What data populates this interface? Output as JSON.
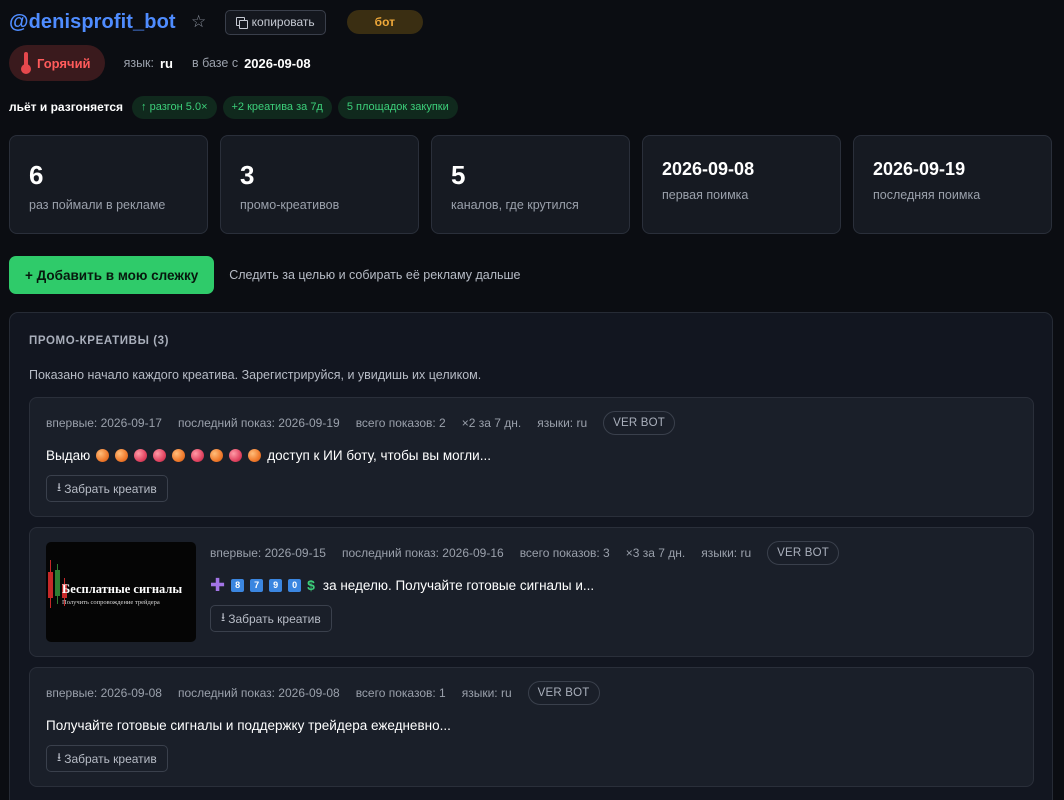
{
  "header": {
    "title": "@denisprofit_bot",
    "copy_label": "копировать",
    "type_badge": "бот",
    "icons": {
      "star": "star-icon",
      "copy": "copy-icon"
    }
  },
  "meta": {
    "status_label": "Горячий",
    "status_icon": "thermometer-icon",
    "lang_label": "язык:",
    "lang_value": "ru",
    "since_label": "в базе с",
    "since_value": "2026-09-08"
  },
  "trend": {
    "label": "льёт и разгоняется",
    "pills": [
      "↑ разгон 5.0×",
      "+2 креатива за 7д",
      "5 площадок закупки"
    ]
  },
  "stats": [
    {
      "value": "6",
      "label": "раз поймали в рекламе"
    },
    {
      "value": "3",
      "label": "промо-креативов"
    },
    {
      "value": "5",
      "label": "каналов, где крутился"
    },
    {
      "value": "2026-09-08",
      "label": "первая поимка"
    },
    {
      "value": "2026-09-19",
      "label": "последняя поимка"
    }
  ],
  "track": {
    "button_label": "+ Добавить в мою слежку",
    "note": "Следить за целью и собирать её рекламу дальше"
  },
  "panel": {
    "title": "ПРОМО-КРЕАТИВЫ (3)",
    "note": "Показано начало каждого креатива. Зарегистрируйся, и увидишь их целиком."
  },
  "creatives": [
    {
      "first_seen": "впервые: 2026-09-17",
      "last_seen": "последний показ: 2026-09-19",
      "total": "всего показов: 2",
      "rate": "×2 за 7 дн.",
      "langs": "языки: ru",
      "tag": "VER BOT",
      "text_start": "Выдаю",
      "text_end": "доступ к ИИ боту, чтобы вы могли...",
      "grab_label": "Забрать креатив"
    },
    {
      "first_seen": "впервые: 2026-09-15",
      "last_seen": "последний показ: 2026-09-16",
      "total": "всего показов: 3",
      "rate": "×3 за 7 дн.",
      "langs": "языки: ru",
      "tag": "VER BOT",
      "digits": [
        "8",
        "7",
        "9",
        "0"
      ],
      "text_end": "за неделю. Получайте готовые сигналы и...",
      "grab_label": "Забрать креатив",
      "thumb_title": "Бесплатные сигналы",
      "thumb_sub": "Получить сопровождение трейдера"
    },
    {
      "first_seen": "впервые: 2026-09-08",
      "last_seen": "последний показ: 2026-09-08",
      "total": "всего показов: 1",
      "langs": "языки: ru",
      "tag": "VER BOT",
      "text_end": "Получайте готовые сигналы и поддержку трейдера ежедневно...",
      "grab_label": "Забрать креатив"
    }
  ],
  "colors": {
    "accent_blue": "#4f8cff",
    "hot_red": "#ff5b5b",
    "success_green": "#2fcb6a",
    "bot_badge": "#f0a93a"
  }
}
